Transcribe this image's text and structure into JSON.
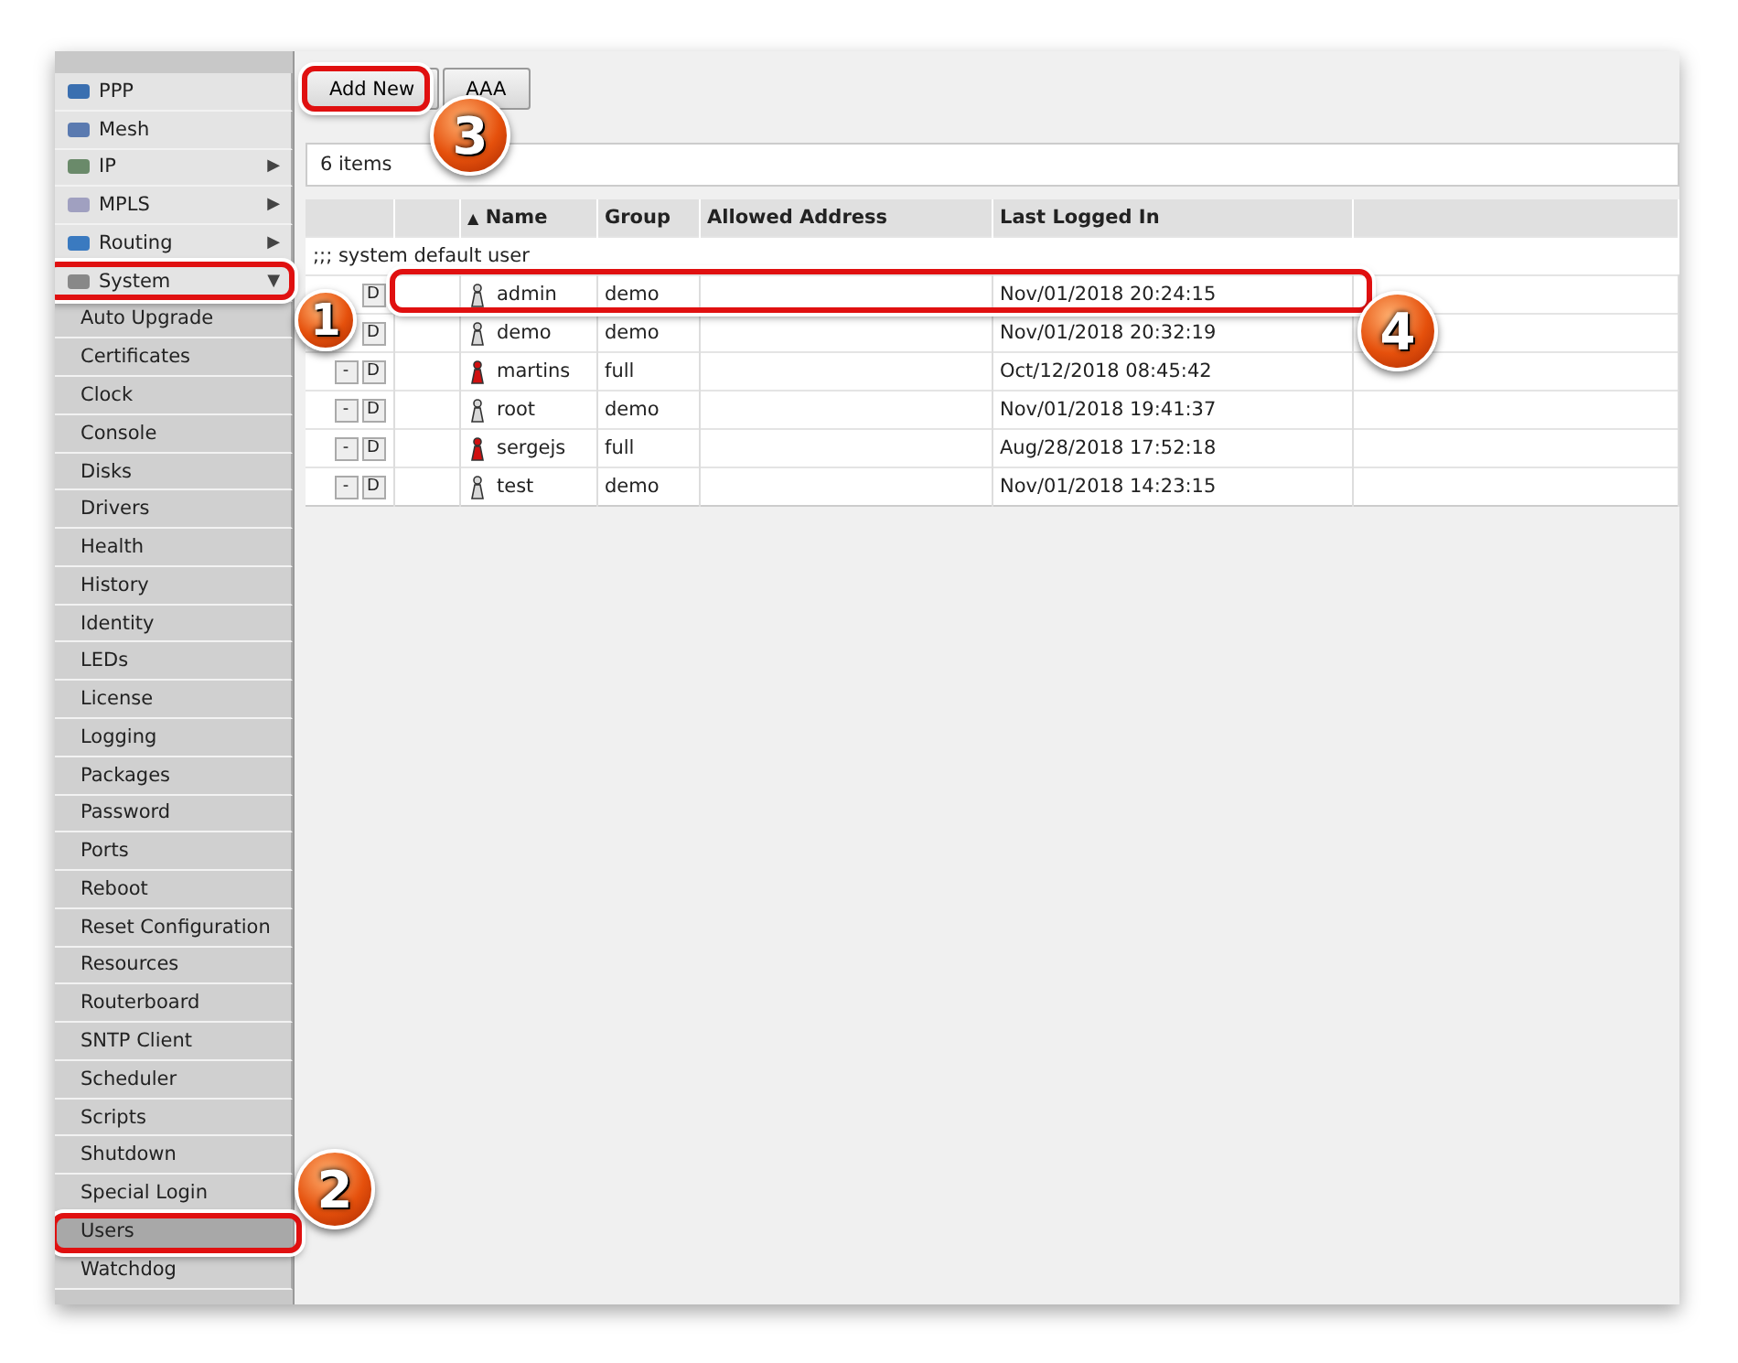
{
  "sidebar": {
    "items": [
      {
        "label": "PPP",
        "kind": "group",
        "selected": false
      },
      {
        "label": "Mesh",
        "kind": "group",
        "selected": false
      },
      {
        "label": "IP",
        "kind": "group",
        "arrow": "▶",
        "selected": false
      },
      {
        "label": "MPLS",
        "kind": "group",
        "arrow": "▶",
        "selected": false
      },
      {
        "label": "Routing",
        "kind": "group",
        "arrow": "▶",
        "selected": false
      },
      {
        "label": "System",
        "kind": "group",
        "arrow": "▼",
        "selected": false
      },
      {
        "label": "Auto Upgrade",
        "kind": "item",
        "selected": false
      },
      {
        "label": "Certificates",
        "kind": "item",
        "selected": false
      },
      {
        "label": "Clock",
        "kind": "item",
        "selected": false
      },
      {
        "label": "Console",
        "kind": "item",
        "selected": false
      },
      {
        "label": "Disks",
        "kind": "item",
        "selected": false
      },
      {
        "label": "Drivers",
        "kind": "item",
        "selected": false
      },
      {
        "label": "Health",
        "kind": "item",
        "selected": false
      },
      {
        "label": "History",
        "kind": "item",
        "selected": false
      },
      {
        "label": "Identity",
        "kind": "item",
        "selected": false
      },
      {
        "label": "LEDs",
        "kind": "item",
        "selected": false
      },
      {
        "label": "License",
        "kind": "item",
        "selected": false
      },
      {
        "label": "Logging",
        "kind": "item",
        "selected": false
      },
      {
        "label": "Packages",
        "kind": "item",
        "selected": false
      },
      {
        "label": "Password",
        "kind": "item",
        "selected": false
      },
      {
        "label": "Ports",
        "kind": "item",
        "selected": false
      },
      {
        "label": "Reboot",
        "kind": "item",
        "selected": false
      },
      {
        "label": "Reset Configuration",
        "kind": "item",
        "selected": false
      },
      {
        "label": "Resources",
        "kind": "item",
        "selected": false
      },
      {
        "label": "Routerboard",
        "kind": "item",
        "selected": false
      },
      {
        "label": "SNTP Client",
        "kind": "item",
        "selected": false
      },
      {
        "label": "Scheduler",
        "kind": "item",
        "selected": false
      },
      {
        "label": "Scripts",
        "kind": "item",
        "selected": false
      },
      {
        "label": "Shutdown",
        "kind": "item",
        "selected": false
      },
      {
        "label": "Special Login",
        "kind": "item",
        "selected": false
      },
      {
        "label": "Users",
        "kind": "item",
        "selected": true
      },
      {
        "label": "Watchdog",
        "kind": "item",
        "selected": false
      }
    ]
  },
  "toolbar": {
    "buttons": [
      "Add New",
      "AAA"
    ]
  },
  "item_count": "6 items",
  "table": {
    "columns": [
      {
        "label": "Name",
        "sort_indicator": "▲"
      },
      {
        "label": "Group"
      },
      {
        "label": "Allowed Address"
      },
      {
        "label": "Last Logged In"
      }
    ],
    "comment": ";;; system default user",
    "rows": [
      {
        "buttons": [
          "D"
        ],
        "name": "admin",
        "group": "demo",
        "last_logged_in": "Nov/01/2018 20:24:15",
        "color": "#d8d8d8"
      },
      {
        "buttons": [
          "D"
        ],
        "name": "demo",
        "group": "demo",
        "last_logged_in": "Nov/01/2018 20:32:19",
        "color": "#d8d8d8"
      },
      {
        "buttons": [
          "-",
          "D"
        ],
        "name": "martins",
        "group": "full",
        "last_logged_in": "Oct/12/2018 08:45:42",
        "color": "#d01010"
      },
      {
        "buttons": [
          "-",
          "D"
        ],
        "name": "root",
        "group": "demo",
        "last_logged_in": "Nov/01/2018 19:41:37",
        "color": "#d8d8d8"
      },
      {
        "buttons": [
          "-",
          "D"
        ],
        "name": "sergejs",
        "group": "full",
        "last_logged_in": "Aug/28/2018 17:52:18",
        "color": "#d01010"
      },
      {
        "buttons": [
          "-",
          "D"
        ],
        "name": "test",
        "group": "demo",
        "last_logged_in": "Nov/01/2018 14:23:15",
        "color": "#d8d8d8"
      }
    ]
  },
  "annotations": [
    {
      "number": "1"
    },
    {
      "number": "2"
    },
    {
      "number": "3"
    },
    {
      "number": "4"
    }
  ]
}
